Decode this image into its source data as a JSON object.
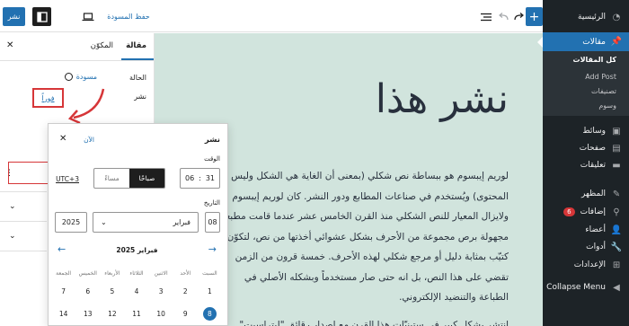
{
  "admin_menu": {
    "items": [
      {
        "label": "الرئيسية",
        "icon": "dashboard-icon"
      },
      {
        "label": "مقالات",
        "icon": "pushpin-icon",
        "active": true
      },
      {
        "label": "وسائط",
        "icon": "media-icon"
      },
      {
        "label": "صفحات",
        "icon": "pages-icon"
      },
      {
        "label": "تعليقات",
        "icon": "comments-icon"
      },
      {
        "label": "المظهر",
        "icon": "appearance-icon"
      },
      {
        "label": "إضافات",
        "icon": "plugins-icon",
        "badge": "6"
      },
      {
        "label": "أعضاء",
        "icon": "users-icon"
      },
      {
        "label": "أدوات",
        "icon": "tools-icon"
      },
      {
        "label": "الإعدادات",
        "icon": "settings-icon"
      },
      {
        "label": "Collapse Menu",
        "icon": "collapse-icon"
      }
    ],
    "submenu": [
      "كل المقالات",
      "Add Post",
      "تصنيفات",
      "وسوم"
    ]
  },
  "toolbar": {
    "publish_label": "نشر",
    "save_draft_label": "حفظ المسودة",
    "add_label": "+"
  },
  "post": {
    "title": "نشر هذا",
    "paragraph_lines": [
      "لوريم إيبسوم هو ببساطة نص شكلي (بمعنى أن الغاية هي الشكل وليس",
      "المحتوى) ويُستخدم في صناعات المطابع ودور النشر. كان لوريم إيبسوم",
      "ولايزال المعيار للنص الشكلي منذ القرن الخامس عشر عندما قامت مطبعة",
      "مجهولة برص مجموعة من الأحرف بشكل عشوائي أخذتها من نص، لتكوّن",
      "كتيّب بمثابة دليل أو مرجع شكلي لهذه الأحرف. خمسة قرون من الزمن",
      "تقضي على هذا النص، بل انه حتى صار مستخدماً وبشكله الأصلي في",
      "الطباعة والتنضيد الإلكتروني.",
      "انتشر بشكل كبير في ستينيّات هذا القرن مع إصدار رقائق \"ليتراسيت\""
    ]
  },
  "sidebar": {
    "tab_post": "مقالة",
    "tab_block": "المكوّن",
    "status_label": "الحالة",
    "status_value": "مسودة",
    "publish_label": "نشر",
    "publish_value": "فوراً"
  },
  "picker": {
    "title": "نشر",
    "now_label": "الآن",
    "time_label": "الوقت",
    "hour": "31",
    "minute": "06",
    "am_label": "صباحًا",
    "pm_label": "مساءً",
    "timezone": "UTC+3",
    "date_label": "التاريخ",
    "day": "08",
    "month": "فبراير",
    "year": "2025",
    "calendar_month": "فبراير 2025",
    "weekdays": [
      "السبت",
      "الأحد",
      "الاثنين",
      "الثلاثاء",
      "الأربعاء",
      "الخميس",
      "الجمعة"
    ],
    "week1": [
      "1",
      "2",
      "3",
      "4",
      "5",
      "6",
      "7"
    ],
    "week2": [
      "8",
      "9",
      "10",
      "11",
      "12",
      "13",
      "14"
    ],
    "selected_day": "8"
  },
  "colors": {
    "admin_bg": "#1d2327",
    "accent": "#2271b1",
    "canvas_bg": "#d1e4dd",
    "highlight": "#d63638"
  }
}
